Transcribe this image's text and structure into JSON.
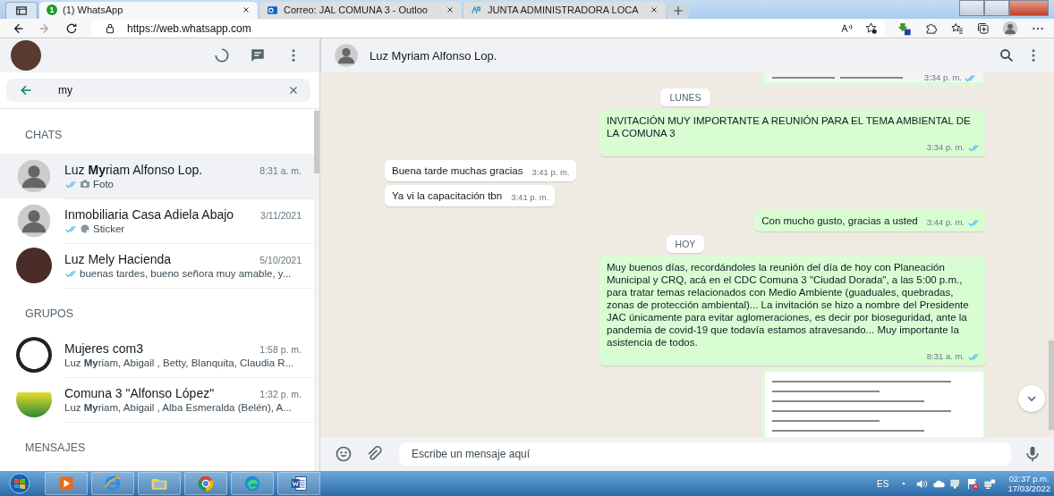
{
  "browser": {
    "tabs": [
      {
        "title": "(1) WhatsApp",
        "badge": "1",
        "selected": true
      },
      {
        "title": "Correo: JAL COMUNA 3 - Outloo",
        "selected": false
      },
      {
        "title": "JUNTA ADMINISTRADORA LOCA",
        "selected": false
      }
    ],
    "url": "https://web.whatsapp.com"
  },
  "sidebar": {
    "search": {
      "value": "my"
    },
    "sections": [
      {
        "title": "CHATS",
        "chats": [
          {
            "name": "Luz **My**riam Alfonso Lop.",
            "time": "8:31 a. m.",
            "preview": "Foto",
            "kind": "photo",
            "read": true,
            "selected": true
          },
          {
            "name": "Inmobiliaria Casa Adiela Abajo",
            "time": "3/11/2021",
            "preview": "Sticker",
            "kind": "sticker",
            "read": true,
            "selected": false
          },
          {
            "name": "Luz Mely Hacienda",
            "time": "5/10/2021",
            "preview": "buenas tardes, bueno señora muy amable, y...",
            "kind": "text",
            "read": true,
            "selected": false
          }
        ]
      },
      {
        "title": "GRUPOS",
        "chats": [
          {
            "name": "Mujeres com3",
            "time": "1:58 p. m.",
            "preview": "Luz **My**riam, Abigail , Betty, Blanquita, Claudia R...",
            "kind": "text",
            "read": false,
            "selected": false
          },
          {
            "name": "Comuna 3 \"Alfonso López\"",
            "time": "1:32 p. m.",
            "preview": "Luz **My**riam, Abigail , Alba Esmeralda (Belén), A...",
            "kind": "text",
            "read": false,
            "selected": false
          }
        ]
      },
      {
        "title": "MENSAJES"
      }
    ]
  },
  "conversation": {
    "name": "Luz Myriam Alfonso Lop.",
    "messages": [
      {
        "kind": "image",
        "outgoing": true,
        "time": "3:34 p. m.",
        "read": true
      },
      {
        "kind": "date",
        "text": "LUNES"
      },
      {
        "kind": "text",
        "outgoing": true,
        "text": "INVITACIÓN MUY IMPORTANTE A REUNIÓN PARA EL TEMA AMBIENTAL DE LA COMUNA 3",
        "time": "3:34 p. m.",
        "read": true
      },
      {
        "kind": "text",
        "outgoing": false,
        "text": "Buena tarde muchas gracias",
        "time": "3:41 p. m."
      },
      {
        "kind": "text",
        "outgoing": false,
        "text": "Ya vi la capacitación tbn",
        "time": "3:41 p. m."
      },
      {
        "kind": "text",
        "outgoing": true,
        "text": "Con mucho gusto, gracias a usted",
        "time": "3:44 p. m.",
        "read": true
      },
      {
        "kind": "date",
        "text": "HOY"
      },
      {
        "kind": "text",
        "outgoing": true,
        "text": "Muy buenos días, recordándoles la reunión del día de hoy con Planeación Municipal y CRQ, acá en el CDC Comuna 3 \"Ciudad Dorada\", a las 5:00 p.m., para tratar temas relacionados con Medio Ambiente (guaduales, quebradas, zonas de protección ambiental)... La invitación se hizo a nombre del Presidente JAC únicamente para evitar aglomeraciones, es decir por bioseguridad, ante la pandemia de covid-19 que todavía estamos atravesando... Muy importante la asistencia de todos.",
        "time": "8:31 a. m.",
        "read": true
      },
      {
        "kind": "document",
        "outgoing": true
      }
    ],
    "composer": {
      "placeholder": "Escribe un mensaje aquí"
    }
  },
  "taskbar": {
    "language": "ES",
    "time": "02:37 p.m.",
    "date": "17/03/2022"
  }
}
